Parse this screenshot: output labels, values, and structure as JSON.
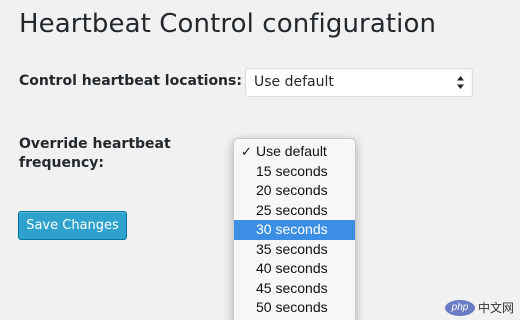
{
  "page": {
    "title": "Heartbeat Control configuration"
  },
  "locations": {
    "label": "Control heartbeat locations:",
    "selected": "Use default"
  },
  "frequency": {
    "label": "Override heartbeat frequency:",
    "options": [
      {
        "label": "Use default",
        "checked": true
      },
      {
        "label": "15 seconds"
      },
      {
        "label": "20 seconds"
      },
      {
        "label": "25 seconds"
      },
      {
        "label": "30 seconds",
        "highlighted": true
      },
      {
        "label": "35 seconds"
      },
      {
        "label": "40 seconds"
      },
      {
        "label": "45 seconds"
      },
      {
        "label": "50 seconds"
      }
    ],
    "check_glyph": "✓"
  },
  "actions": {
    "save_label": "Save Changes"
  },
  "watermark": {
    "logo": "php",
    "text": "中文网"
  },
  "colors": {
    "background": "#f1f1f1",
    "button": "#2ea2cc",
    "highlight": "#3b8ee3"
  }
}
